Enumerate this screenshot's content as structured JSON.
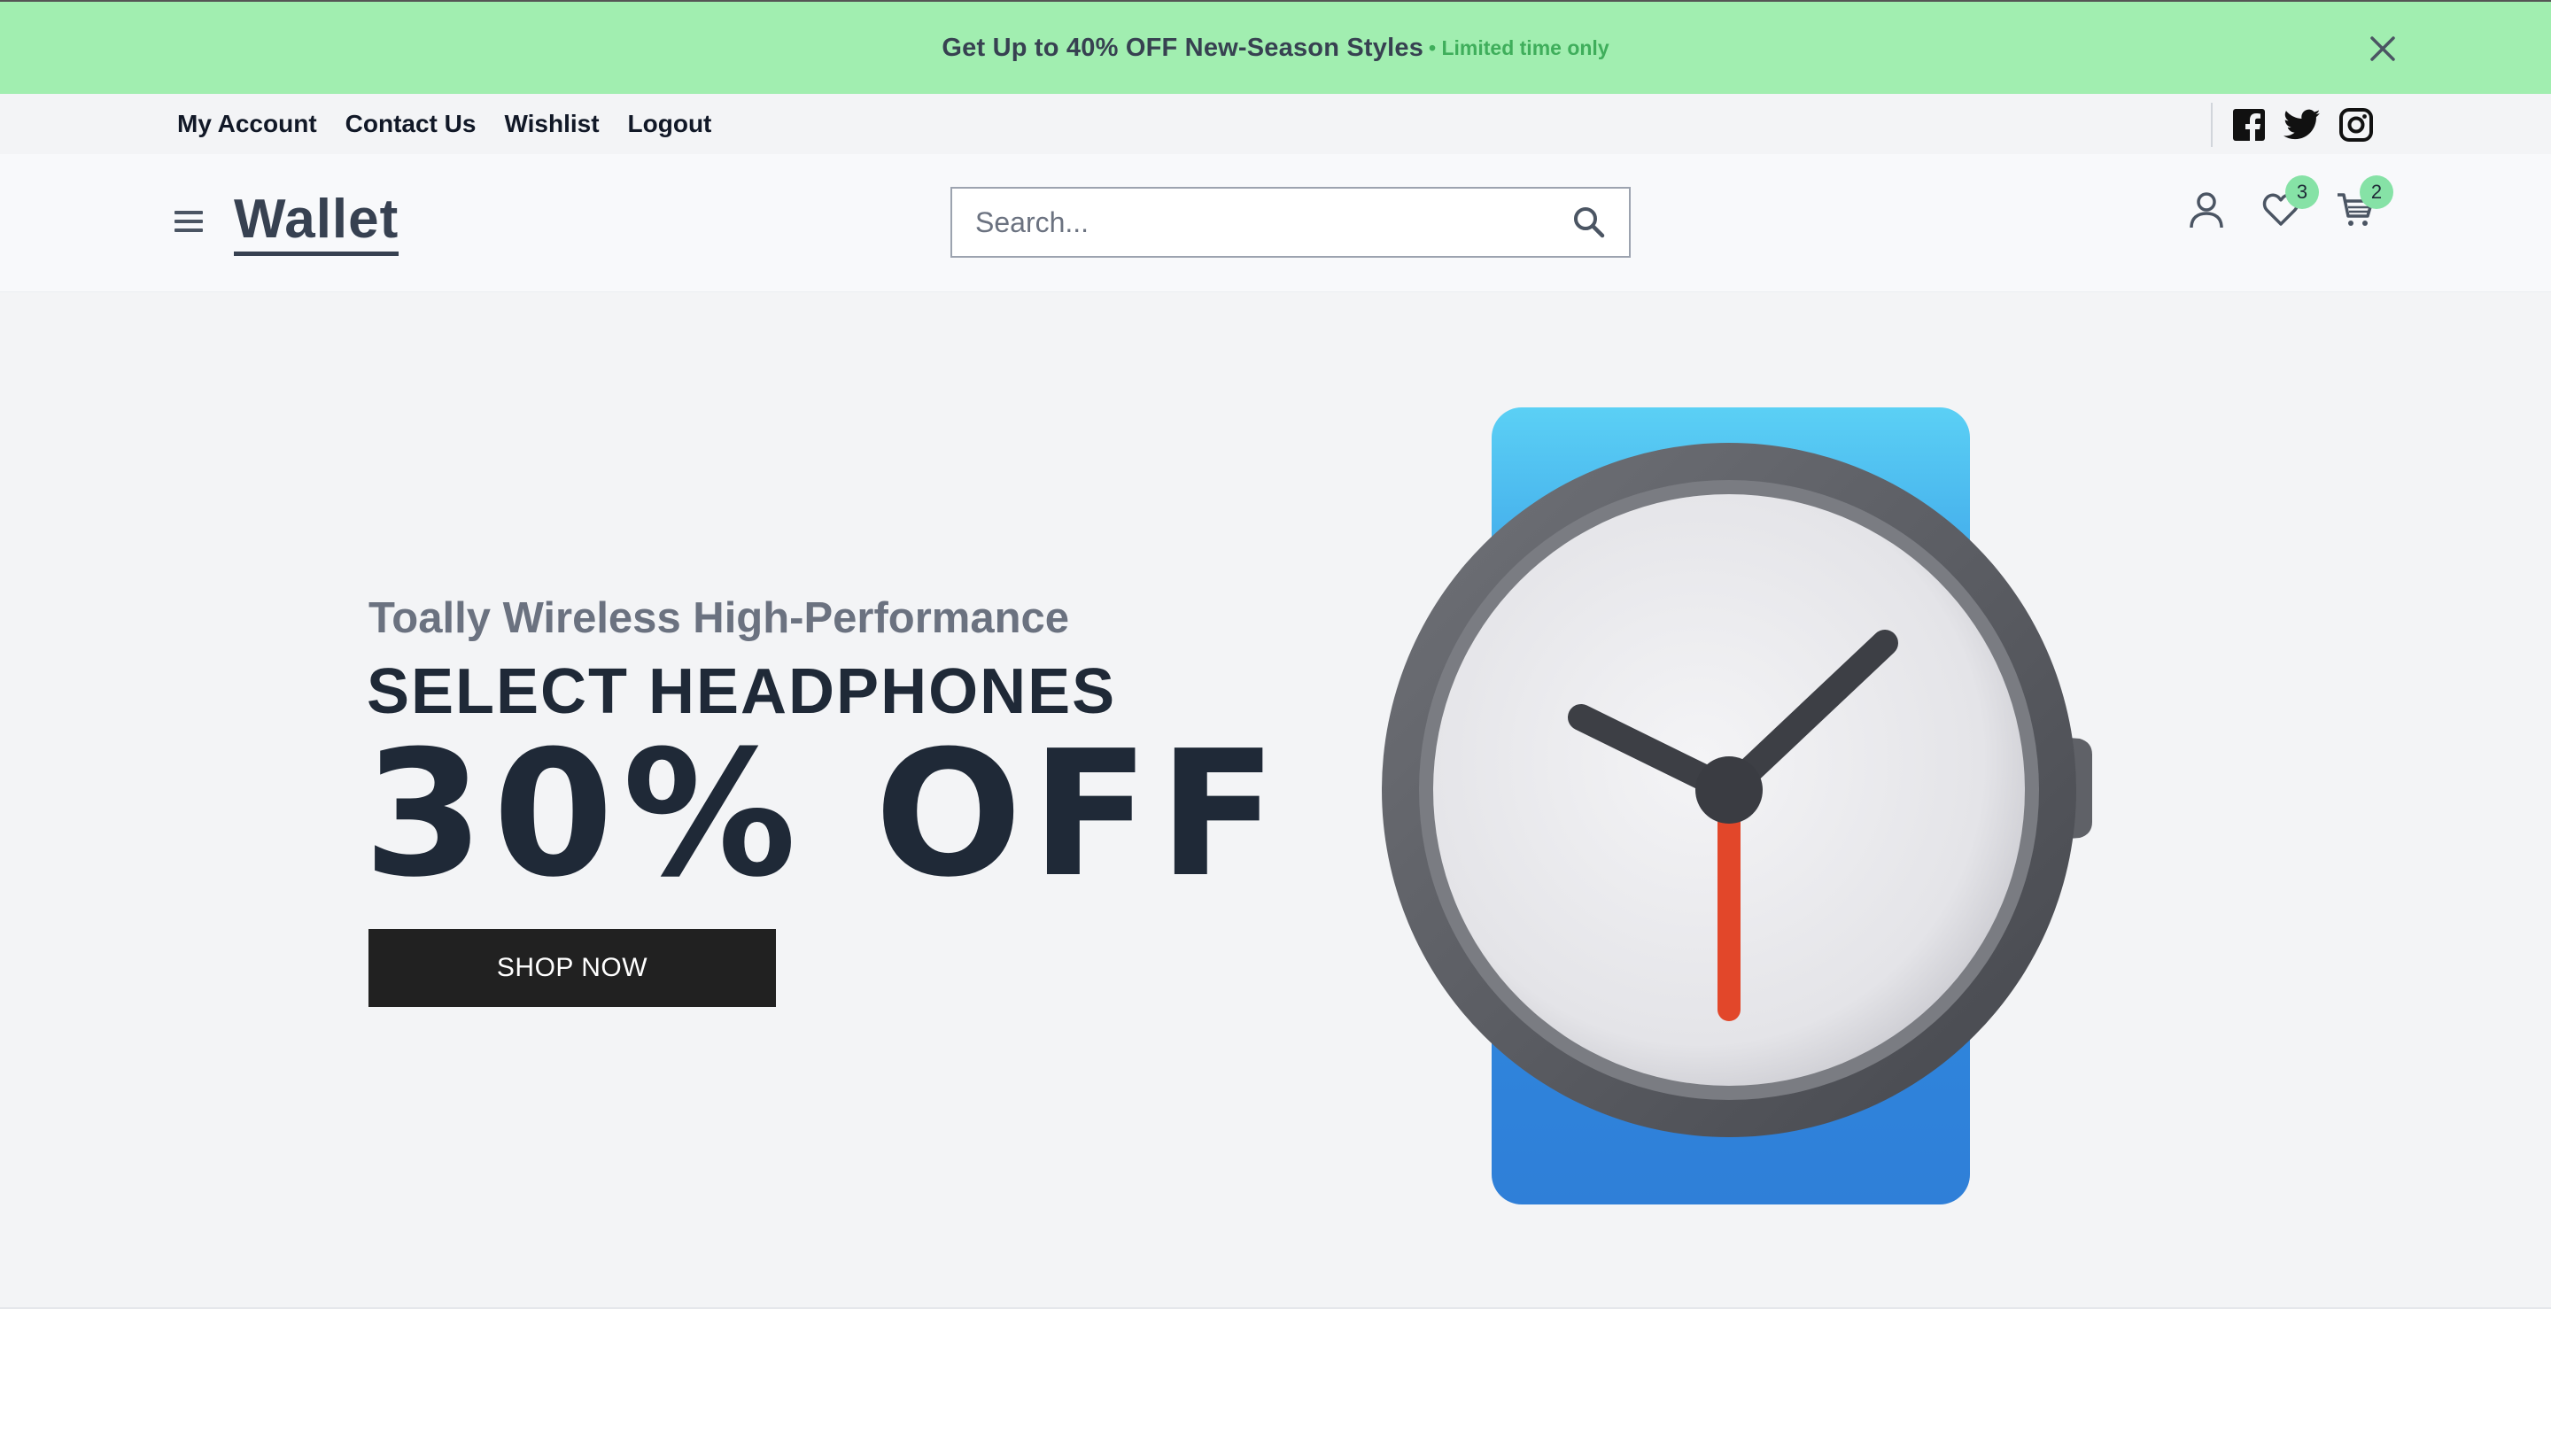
{
  "promo": {
    "text": "Get Up to 40% OFF New-Season Styles",
    "subtext": "• Limited time only",
    "close_icon": "close-icon"
  },
  "topbar": {
    "links": [
      "My Account",
      "Contact Us",
      "Wishlist",
      "Logout"
    ],
    "socials": [
      "facebook-icon",
      "twitter-icon",
      "instagram-icon"
    ]
  },
  "header": {
    "logo": "Wallet",
    "menu_icon": "hamburger-menu-icon",
    "search": {
      "placeholder": "Search...",
      "value": "",
      "icon": "search-icon"
    },
    "wishlist_count": "3",
    "cart_count": "2",
    "icons": [
      "user-icon",
      "heart-icon",
      "cart-icon"
    ]
  },
  "hero": {
    "subtitle": "Toally Wireless High-Performance",
    "title": "SELECT HEADPHONES",
    "offer": "30% OFF",
    "cta": "SHOP NOW",
    "image_icon": "watch-illustration"
  },
  "colors": {
    "promo_bg": "#a1eeb0",
    "promo_accent": "#3fae5b",
    "badge": "#86e2a6",
    "cta_bg": "#212121",
    "watch_band": "#3b96e6",
    "second_hand": "#e8472a"
  }
}
